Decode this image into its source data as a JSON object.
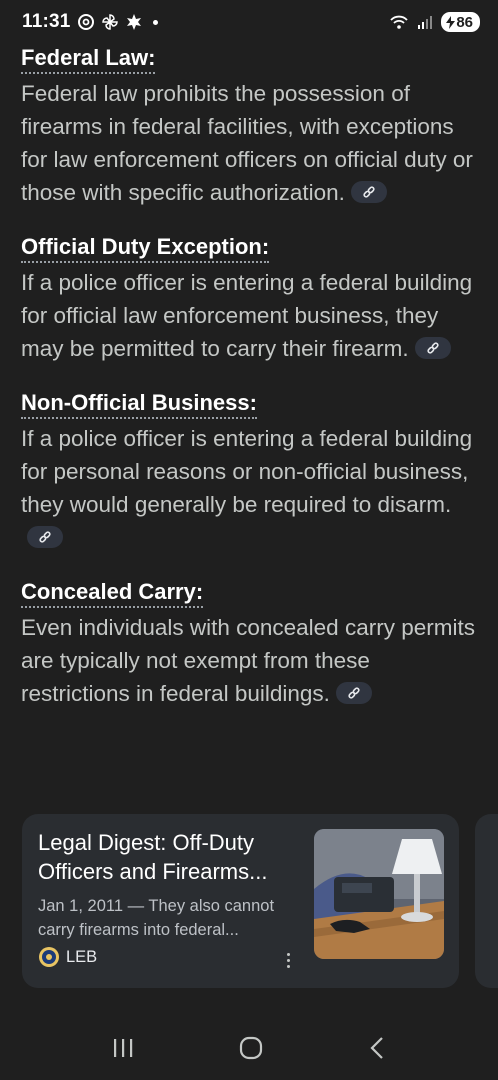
{
  "status_bar": {
    "time": "11:31",
    "battery": "86"
  },
  "sections": [
    {
      "heading": "Federal Law:",
      "text": "Federal law prohibits the possession of firearms in federal facilities, with exceptions for law enforcement officers on official duty or those with specific authorization."
    },
    {
      "heading": "Official Duty Exception:",
      "text": "If a police officer is entering a federal building for official law enforcement business, they may be permitted to carry their firearm."
    },
    {
      "heading": "Non-Official Business:",
      "text": "If a police officer is entering a federal building for personal reasons or non-official business, they would generally be required to disarm."
    },
    {
      "heading": "Concealed Carry:",
      "text": "Even individuals with concealed carry permits are typically not exempt from these restrictions in federal buildings."
    }
  ],
  "card": {
    "title": "Legal Digest: Off-Duty Officers and Firearms...",
    "snippet": "Jan 1, 2011 — They also cannot carry firearms into federal...",
    "source": "LEB"
  },
  "icons": {
    "link": "link-icon",
    "more": "more-vert-icon",
    "nav_recents": "recents-icon",
    "nav_home": "home-icon",
    "nav_back": "back-icon"
  },
  "colors": {
    "background": "#1f1f1f",
    "card": "#2a2d31",
    "chip": "#303540"
  }
}
